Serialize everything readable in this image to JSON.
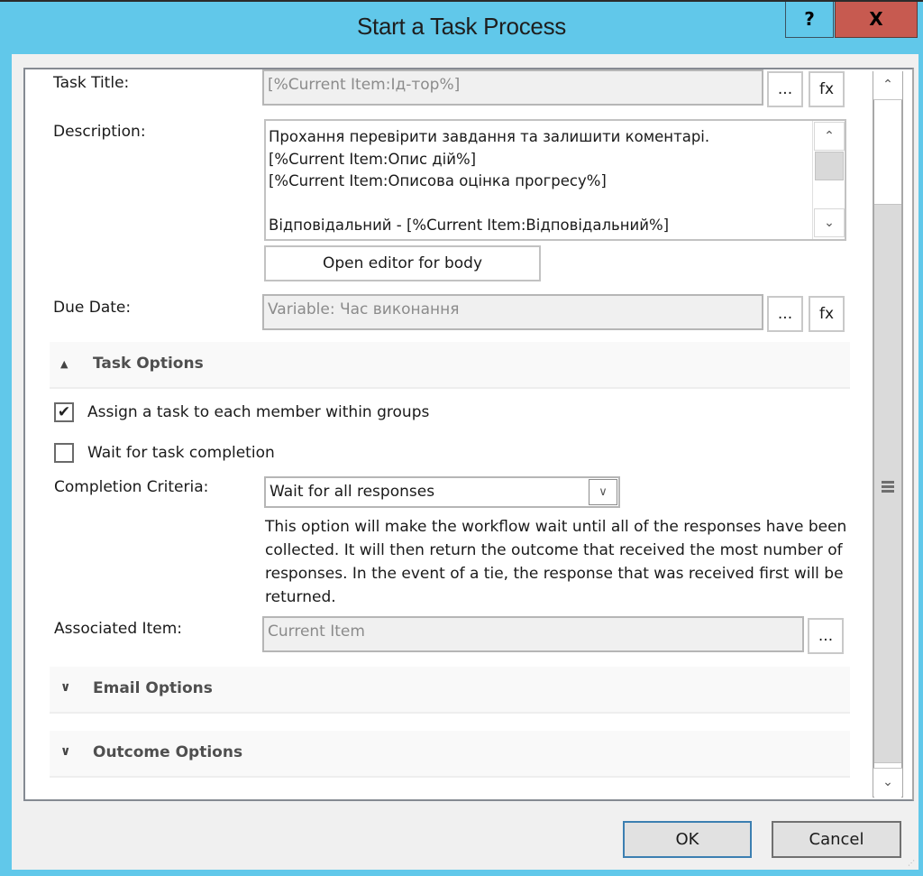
{
  "window": {
    "title": "Start a Task Process",
    "help_label": "?",
    "close_label": "X"
  },
  "form": {
    "task_title": {
      "label": "Task Title:",
      "value": "[%Current Item:Ід-тор%]",
      "lookup_label": "...",
      "fx_label": "fx"
    },
    "description": {
      "label": "Description:",
      "lines": [
        "Прохання перевірити завдання та залишити коментарі.",
        "[%Current Item:Опис дій%]",
        "[%Current Item:Описова оцінка прогресу%]",
        "",
        "Відповідальний - [%Current Item:Відповідальний%]"
      ],
      "open_editor_label": "Open editor for body"
    },
    "due_date": {
      "label": "Due Date:",
      "value": "Variable: Час виконання",
      "lookup_label": "...",
      "fx_label": "fx"
    }
  },
  "task_options": {
    "header": "Task Options",
    "expanded": true,
    "assign_each_member": {
      "label": "Assign a task to each member within groups",
      "checked": true,
      "mark": "✔"
    },
    "wait_for_completion": {
      "label": "Wait for task completion",
      "checked": false
    },
    "completion_criteria": {
      "label": "Completion Criteria:",
      "selected": "Wait for all responses",
      "help": "This option will make the workflow wait until all of the responses have been collected. It will then return the outcome that received the most number of responses. In the event of a tie, the response that was received first will be returned."
    },
    "associated_item": {
      "label": "Associated Item:",
      "value": "Current Item",
      "lookup_label": "..."
    }
  },
  "email_options": {
    "header": "Email Options",
    "expanded": false
  },
  "outcome_options": {
    "header": "Outcome Options",
    "expanded": false
  },
  "icons": {
    "chevron_up": "⌃",
    "chevron_down": "⌄",
    "section_collapse": "▲",
    "section_expand": "∨"
  },
  "buttons": {
    "ok": "OK",
    "cancel": "Cancel"
  }
}
